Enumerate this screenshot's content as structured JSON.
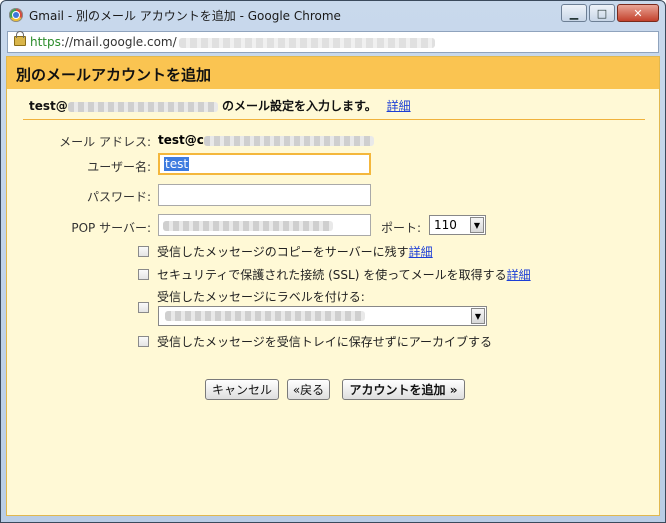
{
  "window": {
    "title": "Gmail - 別のメール アカウントを追加 - Google Chrome",
    "url_scheme": "https",
    "url_text": "://mail.google.com/",
    "minimize_glyph": "▁",
    "maximize_glyph": "□",
    "close_glyph": "✕"
  },
  "dialog": {
    "title": "別のメールアカウントを追加",
    "intro_prefix": "test@",
    "intro_suffix": " のメール設定を入力します。",
    "details_link": "詳細",
    "email_label": "メール アドレス:",
    "email_value_prefix": "test@c",
    "username_label": "ユーザー名:",
    "username_value": "test",
    "password_label": "パスワード:",
    "password_value": "",
    "pop_server_label": "POP サーバー:",
    "port_label": "ポート:",
    "port_value": "110",
    "options": {
      "leave_copy": "受信したメッセージのコピーをサーバーに残す",
      "leave_copy_link": "詳細",
      "use_ssl": "セキュリティで保護された接続 (SSL) を使ってメールを取得する",
      "use_ssl_link": "詳細",
      "label_incoming": "受信したメッセージにラベルを付ける:",
      "archive": "受信したメッセージを受信トレイに保存せずにアーカイブする"
    },
    "buttons": {
      "cancel": "キャンセル",
      "back": "«戻る",
      "add_account": "アカウントを追加 »"
    }
  },
  "colors": {
    "header_bg": "#fac451",
    "dialog_bg": "#fff9d6",
    "link": "#1d3fd6",
    "focus_border": "#f4b73c"
  }
}
